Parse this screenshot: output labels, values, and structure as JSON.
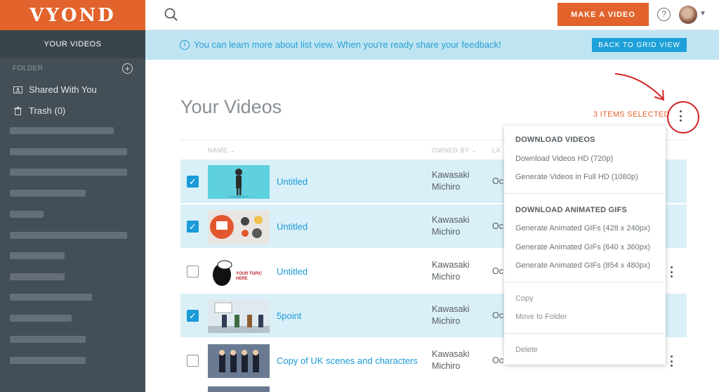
{
  "brand": {
    "logo": "VYOND"
  },
  "sidebar": {
    "header": "YOUR VIDEOS",
    "folder_label": "FOLDER",
    "items": [
      {
        "label": "Shared With You",
        "icon": "shared-folder-icon"
      },
      {
        "label": "Trash (0)",
        "icon": "trash-icon"
      }
    ]
  },
  "topbar": {
    "make_video": "MAKE A VIDEO",
    "help": "?"
  },
  "banner": {
    "text": "You can learn more about list view. When you're ready share your feedback!",
    "button": "BACK TO GRID VIEW"
  },
  "main": {
    "title": "Your Videos",
    "selected": "3 ITEMS SELECTED",
    "columns": {
      "name": "NAME",
      "owned_by": "OWNED BY",
      "last": "LA"
    }
  },
  "videos": [
    {
      "title": "Untitled",
      "owner1": "Kawasaki",
      "owner2": "Michiro",
      "date": "Oc",
      "selected": true
    },
    {
      "title": "Untitled",
      "owner1": "Kawasaki",
      "owner2": "Michiro",
      "date": "Oc",
      "selected": true
    },
    {
      "title": "Untitled",
      "owner1": "Kawasaki",
      "owner2": "Michiro",
      "date": "Oc",
      "selected": false,
      "thumb_text": "YOUR TOPIC HERE"
    },
    {
      "title": "5point",
      "owner1": "Kawasaki",
      "owner2": "Michiro",
      "date": "Oc",
      "selected": true
    },
    {
      "title": "Copy of UK scenes and characters",
      "owner1": "Kawasaki",
      "owner2": "Michiro",
      "date": "Oc",
      "selected": false
    }
  ],
  "menu": {
    "download_videos": "DOWNLOAD VIDEOS",
    "hd": "Download Videos HD (720p)",
    "fullhd": "Generate Videos in Full HD (1080p)",
    "download_gifs": "DOWNLOAD ANIMATED GIFS",
    "gif1": "Generate Animated GIFs (428 x 240px)",
    "gif2": "Generate Animated GIFs (640 x 360px)",
    "gif3": "Generate Animated GIFs (854 x 480px)",
    "copy": "Copy",
    "move": "Move to Folder",
    "delete": "Delete"
  },
  "colors": {
    "brand_orange": "#e2632c",
    "accent_blue": "#1a9ad6",
    "sidebar": "#434e56",
    "banner": "#bfe5f3",
    "annotation_red": "#d2272a"
  }
}
